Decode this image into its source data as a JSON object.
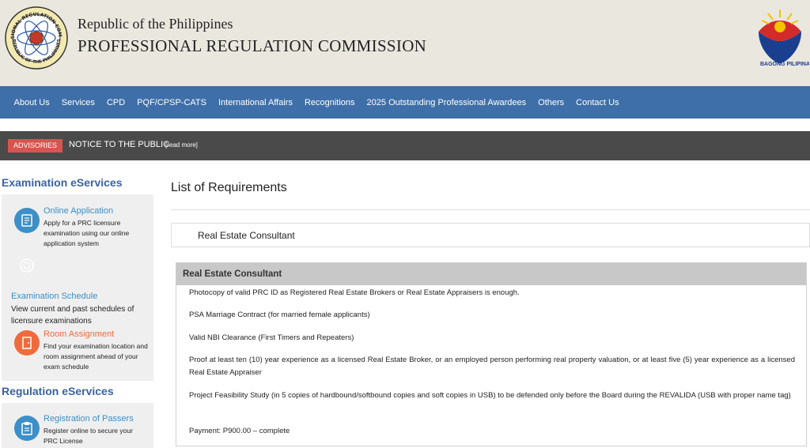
{
  "header": {
    "republic": "Republic of the Philippines",
    "commission": "PROFESSIONAL REGULATION COMMISSION",
    "seal_text_top": "PROFESSIONAL REGULATION COMMISSION",
    "seal_text_bottom": "REPUBLIC OF THE PHILIPPINES",
    "bagong_pilipinas": "BAGONG PILIPINAS"
  },
  "nav": {
    "items": [
      "About Us",
      "Services",
      "CPD",
      "PQF/CPSP-CATS",
      "International Affairs",
      "Recognitions",
      "2025 Outstanding Professional Awardees",
      "Others",
      "Contact Us"
    ]
  },
  "advisory": {
    "badge": "ADVISORIES",
    "notice": "NOTICE TO THE PUBLIC",
    "read_more": "[read more]"
  },
  "sidebar": {
    "exam_title": "Examination eServices",
    "online_app": {
      "label": "Online Application",
      "desc": "Apply for a PRC licensure examination using our online application system"
    },
    "exam_schedule": {
      "label": "Examination Schedule",
      "desc": "View current and past schedules of licensure examinations"
    },
    "room_assignment": {
      "label": "Room Assignment",
      "desc": "Find your examination location and room assignment ahead of your exam schedule"
    },
    "reg_title": "Regulation eServices",
    "reg_passers": {
      "label": "Registration of Passers",
      "desc": "Register online to secure your PRC License"
    }
  },
  "main": {
    "title": "List of Requirements",
    "selected": "Real Estate Consultant",
    "panel_title": "Real Estate Consultant",
    "requirements": [
      "Photocopy of valid PRC ID as Registered Real Estate Brokers or Real Estate Appraisers is enough.",
      "PSA Marriage Contract (for married female applicants)",
      "Valid NBI Clearance (First Timers and Repeaters)",
      "Proof at least ten (10) year experience as a licensed Real Estate Broker, or an employed person performing real property valuation, or at least five (5) year experience as a licensed Real Estate Appraiser",
      "Project Feasibility Study (in 5 copies of hardbound/softbound copies and soft copies in USB) to be defended only before the Board during the REVALIDA (USB with proper name tag)",
      "Payment: P900.00 – complete"
    ]
  },
  "colors": {
    "nav_bg": "#3f6fa8",
    "header_bg": "#eae7df",
    "advisory_bg": "#4a4a4a",
    "badge_red": "#d9534f",
    "link_blue": "#3d8fc7",
    "title_blue": "#3a63a0",
    "icon_blue": "#3d8fc7",
    "icon_orange": "#ef6b3c"
  },
  "icons": {
    "seal": "prc-seal-icon",
    "bagong": "bagong-pilipinas-logo",
    "online": "application-form-icon",
    "schedule": "calendar-icon",
    "room": "door-icon",
    "passers": "clipboard-icon"
  }
}
